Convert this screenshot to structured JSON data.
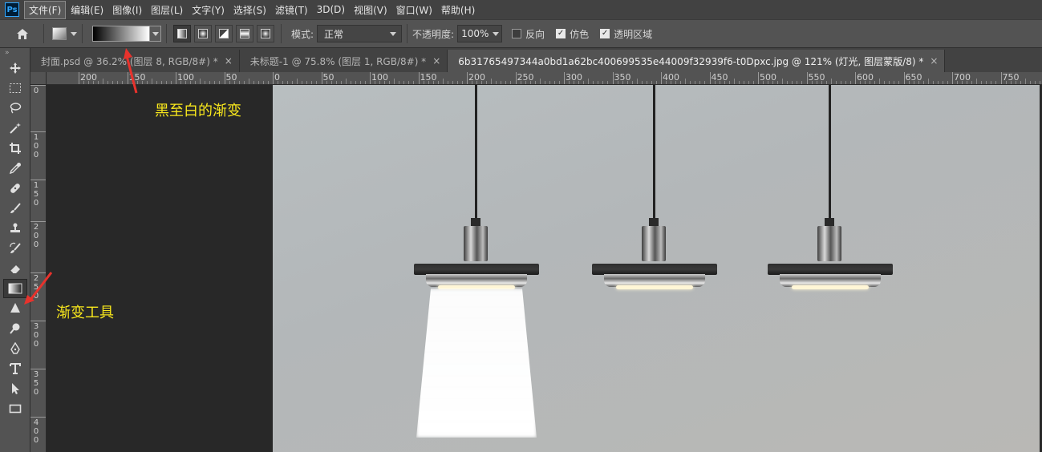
{
  "app": {
    "logo": "Ps"
  },
  "menu": [
    "文件(F)",
    "编辑(E)",
    "图像(I)",
    "图层(L)",
    "文字(Y)",
    "选择(S)",
    "滤镜(T)",
    "3D(D)",
    "视图(V)",
    "窗口(W)",
    "帮助(H)"
  ],
  "options": {
    "gradient": {
      "from": "#000000",
      "to": "#ffffff"
    },
    "mode_label": "模式:",
    "mode_value": "正常",
    "opacity_label": "不透明度:",
    "opacity_value": "100%",
    "reverse_label": "反向",
    "reverse_checked": false,
    "dither_label": "仿色",
    "dither_checked": true,
    "transparency_label": "透明区域",
    "transparency_checked": true
  },
  "tabs": [
    {
      "title": "封面.psd @ 36.2% (图层 8, RGB/8#) *",
      "close": "×",
      "active": false
    },
    {
      "title": "未标题-1 @ 75.8% (图层 1, RGB/8#) *",
      "close": "×",
      "active": false
    },
    {
      "title": "6b31765497344a0bd1a62bc400699535e44009f32939f6-t0Dpxc.jpg @ 121% (灯光, 图层蒙版/8) *",
      "close": "×",
      "active": true
    }
  ],
  "ruler_top": [
    "200",
    "150",
    "100",
    "50",
    "0",
    "50",
    "100",
    "150",
    "200",
    "250",
    "300",
    "350",
    "400",
    "450",
    "500",
    "550",
    "600",
    "650",
    "700",
    "750"
  ],
  "ruler_left": [
    "0",
    "100",
    "150",
    "200",
    "250",
    "300",
    "350",
    "400"
  ],
  "annotations": {
    "gradient_label": "黑至白的渐变",
    "tool_label": "渐变工具",
    "color": "#f8e71c",
    "arrow_color": "#e8322c"
  }
}
